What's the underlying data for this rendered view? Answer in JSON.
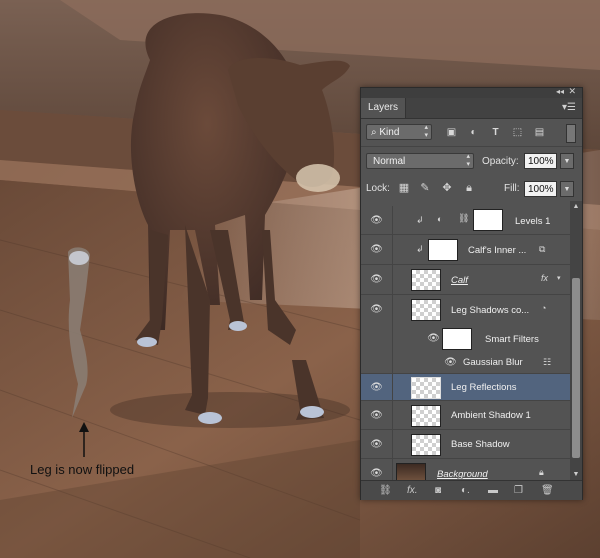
{
  "annotation": {
    "text": "Leg is now flipped"
  },
  "panel": {
    "tab_label": "Layers",
    "menu_icon": "panel-menu-icon",
    "filter": {
      "kind_label": "Kind"
    },
    "blend": {
      "mode": "Normal",
      "opacity_label": "Opacity:",
      "opacity_value": "100%"
    },
    "lock": {
      "lock_label": "Lock:",
      "fill_label": "Fill:",
      "fill_value": "100%"
    },
    "layers": [
      {
        "name": "Levels 1",
        "type": "adjustment"
      },
      {
        "name": "Calf's Inner ...",
        "type": "clipped"
      },
      {
        "name": "Calf",
        "type": "group-fx"
      },
      {
        "name": "Leg Shadows co...",
        "type": "smart-object"
      },
      {
        "name": "Smart Filters",
        "type": "smart-filters"
      },
      {
        "name": "Gaussian Blur",
        "type": "filter"
      },
      {
        "name": "Leg Reflections",
        "type": "layer",
        "selected": true
      },
      {
        "name": "Ambient Shadow 1",
        "type": "layer"
      },
      {
        "name": "Base Shadow",
        "type": "layer"
      },
      {
        "name": "Background",
        "type": "background"
      }
    ],
    "colors": {
      "selected": "#52647e",
      "panel_bg": "#535353"
    }
  }
}
